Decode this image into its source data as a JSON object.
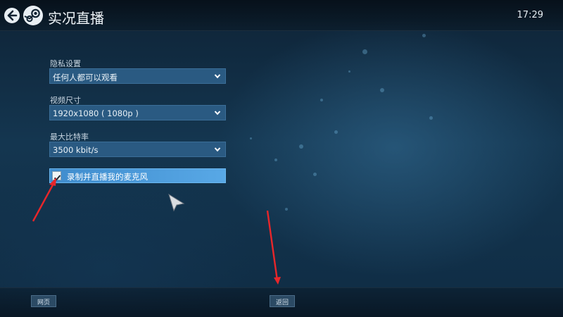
{
  "header": {
    "title": "实况直播",
    "clock": "17:29"
  },
  "settings": {
    "privacy": {
      "label": "隐私设置",
      "value": "任何人都可以观看"
    },
    "video_size": {
      "label": "视频尺寸",
      "value": "1920x1080 ( 1080p )"
    },
    "max_bitrate": {
      "label": "最大比特率",
      "value": "3500 kbit/s"
    },
    "microphone": {
      "label": "录制并直播我的麦克风",
      "checked": true
    }
  },
  "footer": {
    "web_label": "网页",
    "back_label": "返回"
  },
  "colors": {
    "accent": "#4a9ee0",
    "annotation": "#e8262a"
  }
}
